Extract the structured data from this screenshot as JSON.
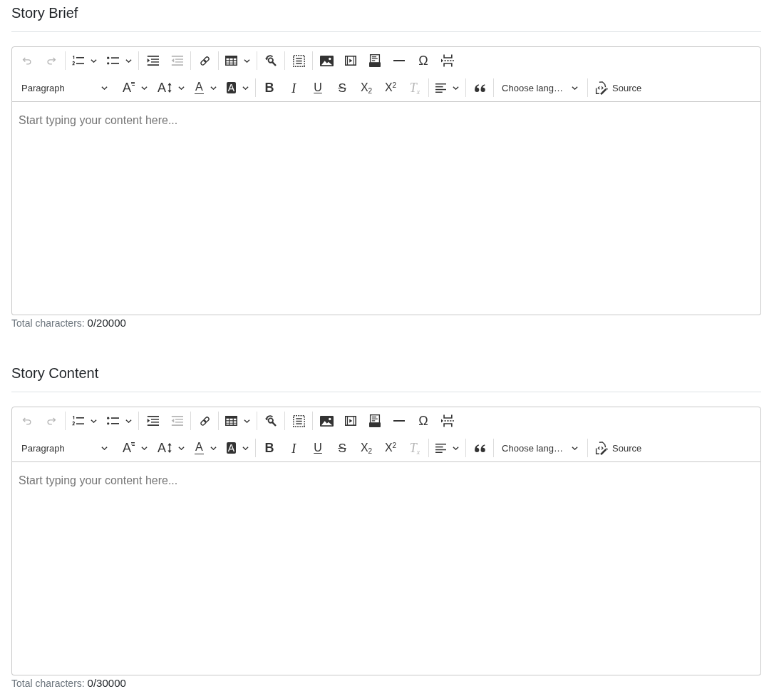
{
  "editors": [
    {
      "title": "Story Brief",
      "toolbar": [
        [
          {
            "kind": "undo",
            "disabled": true,
            "dropdown": false
          },
          {
            "kind": "redo",
            "disabled": true,
            "dropdown": false
          },
          {
            "kind": "separator"
          },
          {
            "kind": "numbered",
            "disabled": false,
            "dropdown": true
          },
          {
            "kind": "bulleted",
            "disabled": false,
            "dropdown": true
          },
          {
            "kind": "separator"
          },
          {
            "kind": "indent",
            "disabled": false,
            "dropdown": false
          },
          {
            "kind": "outdent",
            "disabled": true,
            "dropdown": false
          },
          {
            "kind": "separator"
          },
          {
            "kind": "link",
            "disabled": false,
            "dropdown": false
          },
          {
            "kind": "separator"
          },
          {
            "kind": "table",
            "disabled": false,
            "dropdown": true
          },
          {
            "kind": "separator"
          },
          {
            "kind": "findreplace",
            "disabled": false,
            "dropdown": false
          },
          {
            "kind": "separator"
          },
          {
            "kind": "showblocks",
            "disabled": false,
            "dropdown": false
          },
          {
            "kind": "separator"
          },
          {
            "kind": "image",
            "disabled": false,
            "dropdown": false
          },
          {
            "kind": "media",
            "disabled": false,
            "dropdown": false
          },
          {
            "kind": "htmlembed",
            "disabled": false,
            "dropdown": false
          },
          {
            "kind": "hrule",
            "disabled": false,
            "dropdown": false
          },
          {
            "kind": "specialchars",
            "glyph": "Ω",
            "disabled": false,
            "dropdown": false
          },
          {
            "kind": "pagebreak",
            "disabled": false,
            "dropdown": false
          }
        ],
        [
          {
            "kind": "heading",
            "label": "Paragraph",
            "disabled": false,
            "dropdown": true
          },
          {
            "kind": "fontfamily",
            "glyph": "A",
            "disabled": false,
            "dropdown": true
          },
          {
            "kind": "fontsize",
            "glyph": "A",
            "disabled": false,
            "dropdown": true
          },
          {
            "kind": "fontcolor",
            "glyph": "A",
            "disabled": false,
            "dropdown": true
          },
          {
            "kind": "fontbackground",
            "glyph": "A",
            "disabled": false,
            "dropdown": true
          },
          {
            "kind": "separator"
          },
          {
            "kind": "bold",
            "glyph": "B",
            "disabled": false,
            "dropdown": false
          },
          {
            "kind": "italic",
            "glyph": "I",
            "disabled": false,
            "dropdown": false
          },
          {
            "kind": "underline",
            "glyph": "U",
            "disabled": false,
            "dropdown": false
          },
          {
            "kind": "strikethrough",
            "glyph": "S",
            "disabled": false,
            "dropdown": false
          },
          {
            "kind": "subscript",
            "glyph": "X$_{2}$",
            "disabled": false,
            "dropdown": false
          },
          {
            "kind": "superscript",
            "glyph": "X$^{2}$",
            "disabled": false,
            "dropdown": false
          },
          {
            "kind": "removeformat",
            "glyph": "T$_{x}$",
            "disabled": true,
            "dropdown": false
          },
          {
            "kind": "separator"
          },
          {
            "kind": "alignment",
            "disabled": false,
            "dropdown": true
          },
          {
            "kind": "separator"
          },
          {
            "kind": "blockquote",
            "disabled": false,
            "dropdown": false
          },
          {
            "kind": "separator"
          },
          {
            "kind": "language",
            "label": "Choose lang…",
            "disabled": false,
            "dropdown": true
          },
          {
            "kind": "separator"
          },
          {
            "kind": "source",
            "label": "Source",
            "disabled": false,
            "dropdown": false
          }
        ]
      ],
      "placeholder": "Start typing your content here...",
      "counter_label": "Total characters:",
      "counter_value": "0/20000"
    },
    {
      "title": "Story Content",
      "toolbar": [
        [
          {
            "kind": "undo",
            "disabled": true,
            "dropdown": false
          },
          {
            "kind": "redo",
            "disabled": true,
            "dropdown": false
          },
          {
            "kind": "separator"
          },
          {
            "kind": "numbered",
            "disabled": false,
            "dropdown": true
          },
          {
            "kind": "bulleted",
            "disabled": false,
            "dropdown": true
          },
          {
            "kind": "separator"
          },
          {
            "kind": "indent",
            "disabled": false,
            "dropdown": false
          },
          {
            "kind": "outdent",
            "disabled": true,
            "dropdown": false
          },
          {
            "kind": "separator"
          },
          {
            "kind": "link",
            "disabled": false,
            "dropdown": false
          },
          {
            "kind": "separator"
          },
          {
            "kind": "table",
            "disabled": false,
            "dropdown": true
          },
          {
            "kind": "separator"
          },
          {
            "kind": "findreplace",
            "disabled": false,
            "dropdown": false
          },
          {
            "kind": "separator"
          },
          {
            "kind": "showblocks",
            "disabled": false,
            "dropdown": false
          },
          {
            "kind": "separator"
          },
          {
            "kind": "image",
            "disabled": false,
            "dropdown": false
          },
          {
            "kind": "media",
            "disabled": false,
            "dropdown": false
          },
          {
            "kind": "htmlembed",
            "disabled": false,
            "dropdown": false
          },
          {
            "kind": "hrule",
            "disabled": false,
            "dropdown": false
          },
          {
            "kind": "specialchars",
            "glyph": "Ω",
            "disabled": false,
            "dropdown": false
          },
          {
            "kind": "pagebreak",
            "disabled": false,
            "dropdown": false
          }
        ],
        [
          {
            "kind": "heading",
            "label": "Paragraph",
            "disabled": false,
            "dropdown": true
          },
          {
            "kind": "fontfamily",
            "glyph": "A",
            "disabled": false,
            "dropdown": true
          },
          {
            "kind": "fontsize",
            "glyph": "A",
            "disabled": false,
            "dropdown": true
          },
          {
            "kind": "fontcolor",
            "glyph": "A",
            "disabled": false,
            "dropdown": true
          },
          {
            "kind": "fontbackground",
            "glyph": "A",
            "disabled": false,
            "dropdown": true
          },
          {
            "kind": "separator"
          },
          {
            "kind": "bold",
            "glyph": "B",
            "disabled": false,
            "dropdown": false
          },
          {
            "kind": "italic",
            "glyph": "I",
            "disabled": false,
            "dropdown": false
          },
          {
            "kind": "underline",
            "glyph": "U",
            "disabled": false,
            "dropdown": false
          },
          {
            "kind": "strikethrough",
            "glyph": "S",
            "disabled": false,
            "dropdown": false
          },
          {
            "kind": "subscript",
            "glyph": "X$_{2}$",
            "disabled": false,
            "dropdown": false
          },
          {
            "kind": "superscript",
            "glyph": "X$^{2}$",
            "disabled": false,
            "dropdown": false
          },
          {
            "kind": "removeformat",
            "glyph": "T$_{x}$",
            "disabled": true,
            "dropdown": false
          },
          {
            "kind": "separator"
          },
          {
            "kind": "alignment",
            "disabled": false,
            "dropdown": true
          },
          {
            "kind": "separator"
          },
          {
            "kind": "blockquote",
            "disabled": false,
            "dropdown": false
          },
          {
            "kind": "separator"
          },
          {
            "kind": "language",
            "label": "Choose lang…",
            "disabled": false,
            "dropdown": true
          },
          {
            "kind": "separator"
          },
          {
            "kind": "source",
            "label": "Source",
            "disabled": false,
            "dropdown": false
          }
        ]
      ],
      "placeholder": "Start typing your content here...",
      "counter_label": "Total characters:",
      "counter_value": "0/30000"
    }
  ]
}
